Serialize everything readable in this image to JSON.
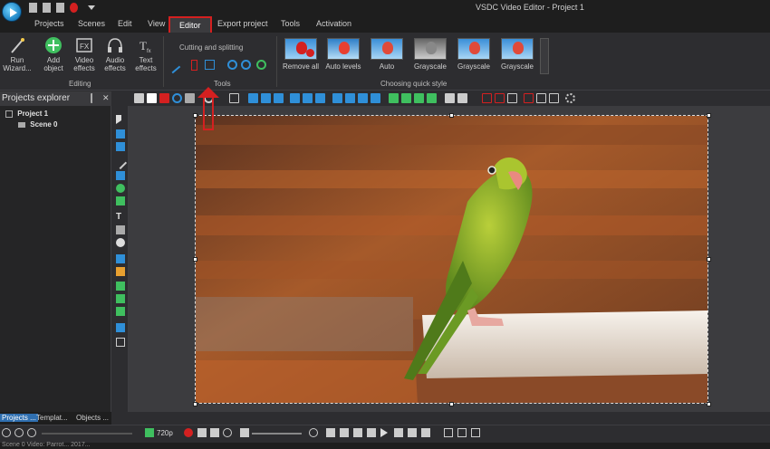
{
  "window": {
    "title": "VSDC Video Editor - Project 1"
  },
  "menu": {
    "tabs": [
      "Projects",
      "Scenes",
      "Edit",
      "View",
      "Editor",
      "Export project",
      "Tools",
      "Activation"
    ],
    "active": "Editor"
  },
  "ribbon": {
    "run_wizard": [
      "Run",
      "Wizard..."
    ],
    "add_object": [
      "Add",
      "object"
    ],
    "video_effects": [
      "Video",
      "effects"
    ],
    "audio_effects": [
      "Audio",
      "effects"
    ],
    "text_effects": [
      "Text",
      "effects"
    ],
    "editing_label": "Editing",
    "cutting_label": "Cutting and splitting",
    "tools_label": "Tools",
    "quick_style_label": "Choosing quick style",
    "styles": [
      "Remove all",
      "Auto levels",
      "Auto",
      "Grayscale",
      "Grayscale",
      "Grayscale"
    ]
  },
  "projects_explorer": {
    "title": "Projects explorer",
    "project": "Project 1",
    "scene": "Scene 0",
    "tabs": [
      "Projects ...",
      "Templat...",
      "Objects ..."
    ]
  },
  "player": {
    "resolution": "720p"
  },
  "status": {
    "text": "Scene 0   Video: Parrot... 2017..."
  },
  "colors": {
    "accent_red": "#d42020",
    "toolbar_blue": "#2f8fd8",
    "toolbar_green": "#3fbf5f"
  }
}
